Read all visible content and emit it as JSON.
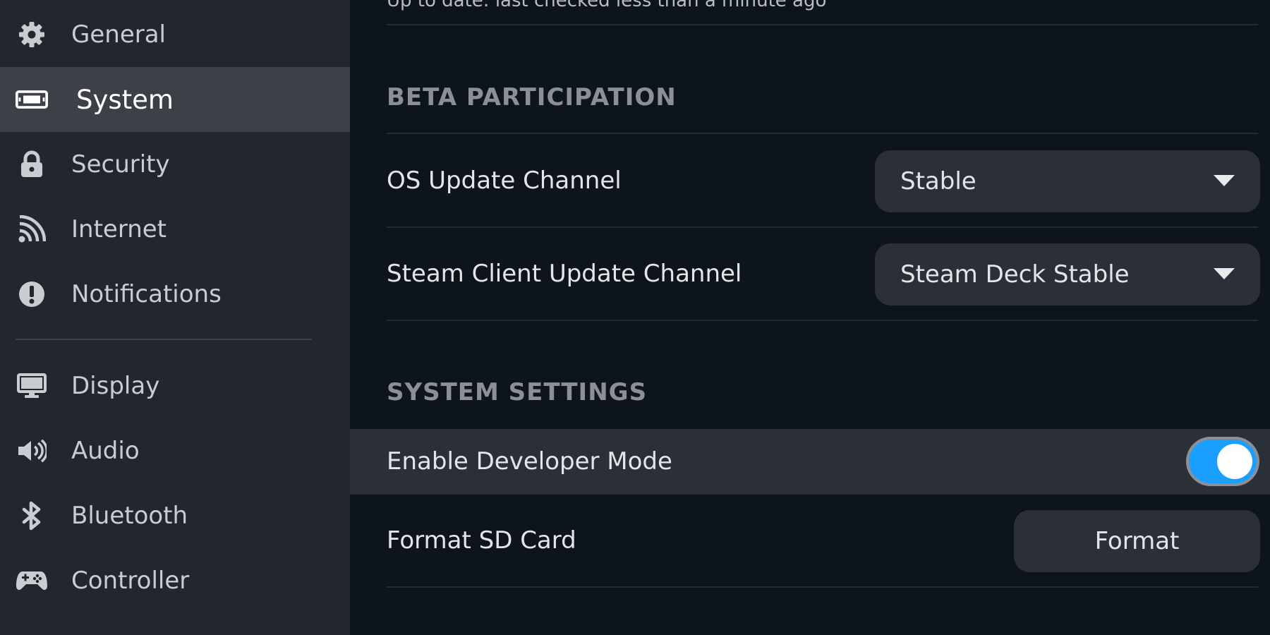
{
  "sidebar": {
    "items": [
      {
        "label": "General",
        "icon": "gear-icon"
      },
      {
        "label": "System",
        "icon": "system-icon",
        "active": true
      },
      {
        "label": "Security",
        "icon": "lock-icon"
      },
      {
        "label": "Internet",
        "icon": "wifi-icon"
      },
      {
        "label": "Notifications",
        "icon": "alert-icon"
      },
      {
        "label": "Display",
        "icon": "monitor-icon"
      },
      {
        "label": "Audio",
        "icon": "speaker-icon"
      },
      {
        "label": "Bluetooth",
        "icon": "bluetooth-icon"
      },
      {
        "label": "Controller",
        "icon": "gamepad-icon"
      }
    ]
  },
  "main": {
    "update_status": "Up to date: last checked less than a minute ago",
    "beta": {
      "heading": "BETA PARTICIPATION",
      "os_channel": {
        "label": "OS Update Channel",
        "value": "Stable"
      },
      "client_channel": {
        "label": "Steam Client Update Channel",
        "value": "Steam Deck Stable"
      }
    },
    "system_settings": {
      "heading": "SYSTEM SETTINGS",
      "developer_mode": {
        "label": "Enable Developer Mode",
        "enabled": true
      },
      "format_sd": {
        "label": "Format SD Card",
        "button_label": "Format"
      }
    }
  },
  "colors": {
    "accent": "#1a9fff",
    "sidebar_bg": "#23262e",
    "sidebar_active": "#3d4047",
    "main_bg": "#0e141b",
    "control_bg": "#2b2f37"
  }
}
